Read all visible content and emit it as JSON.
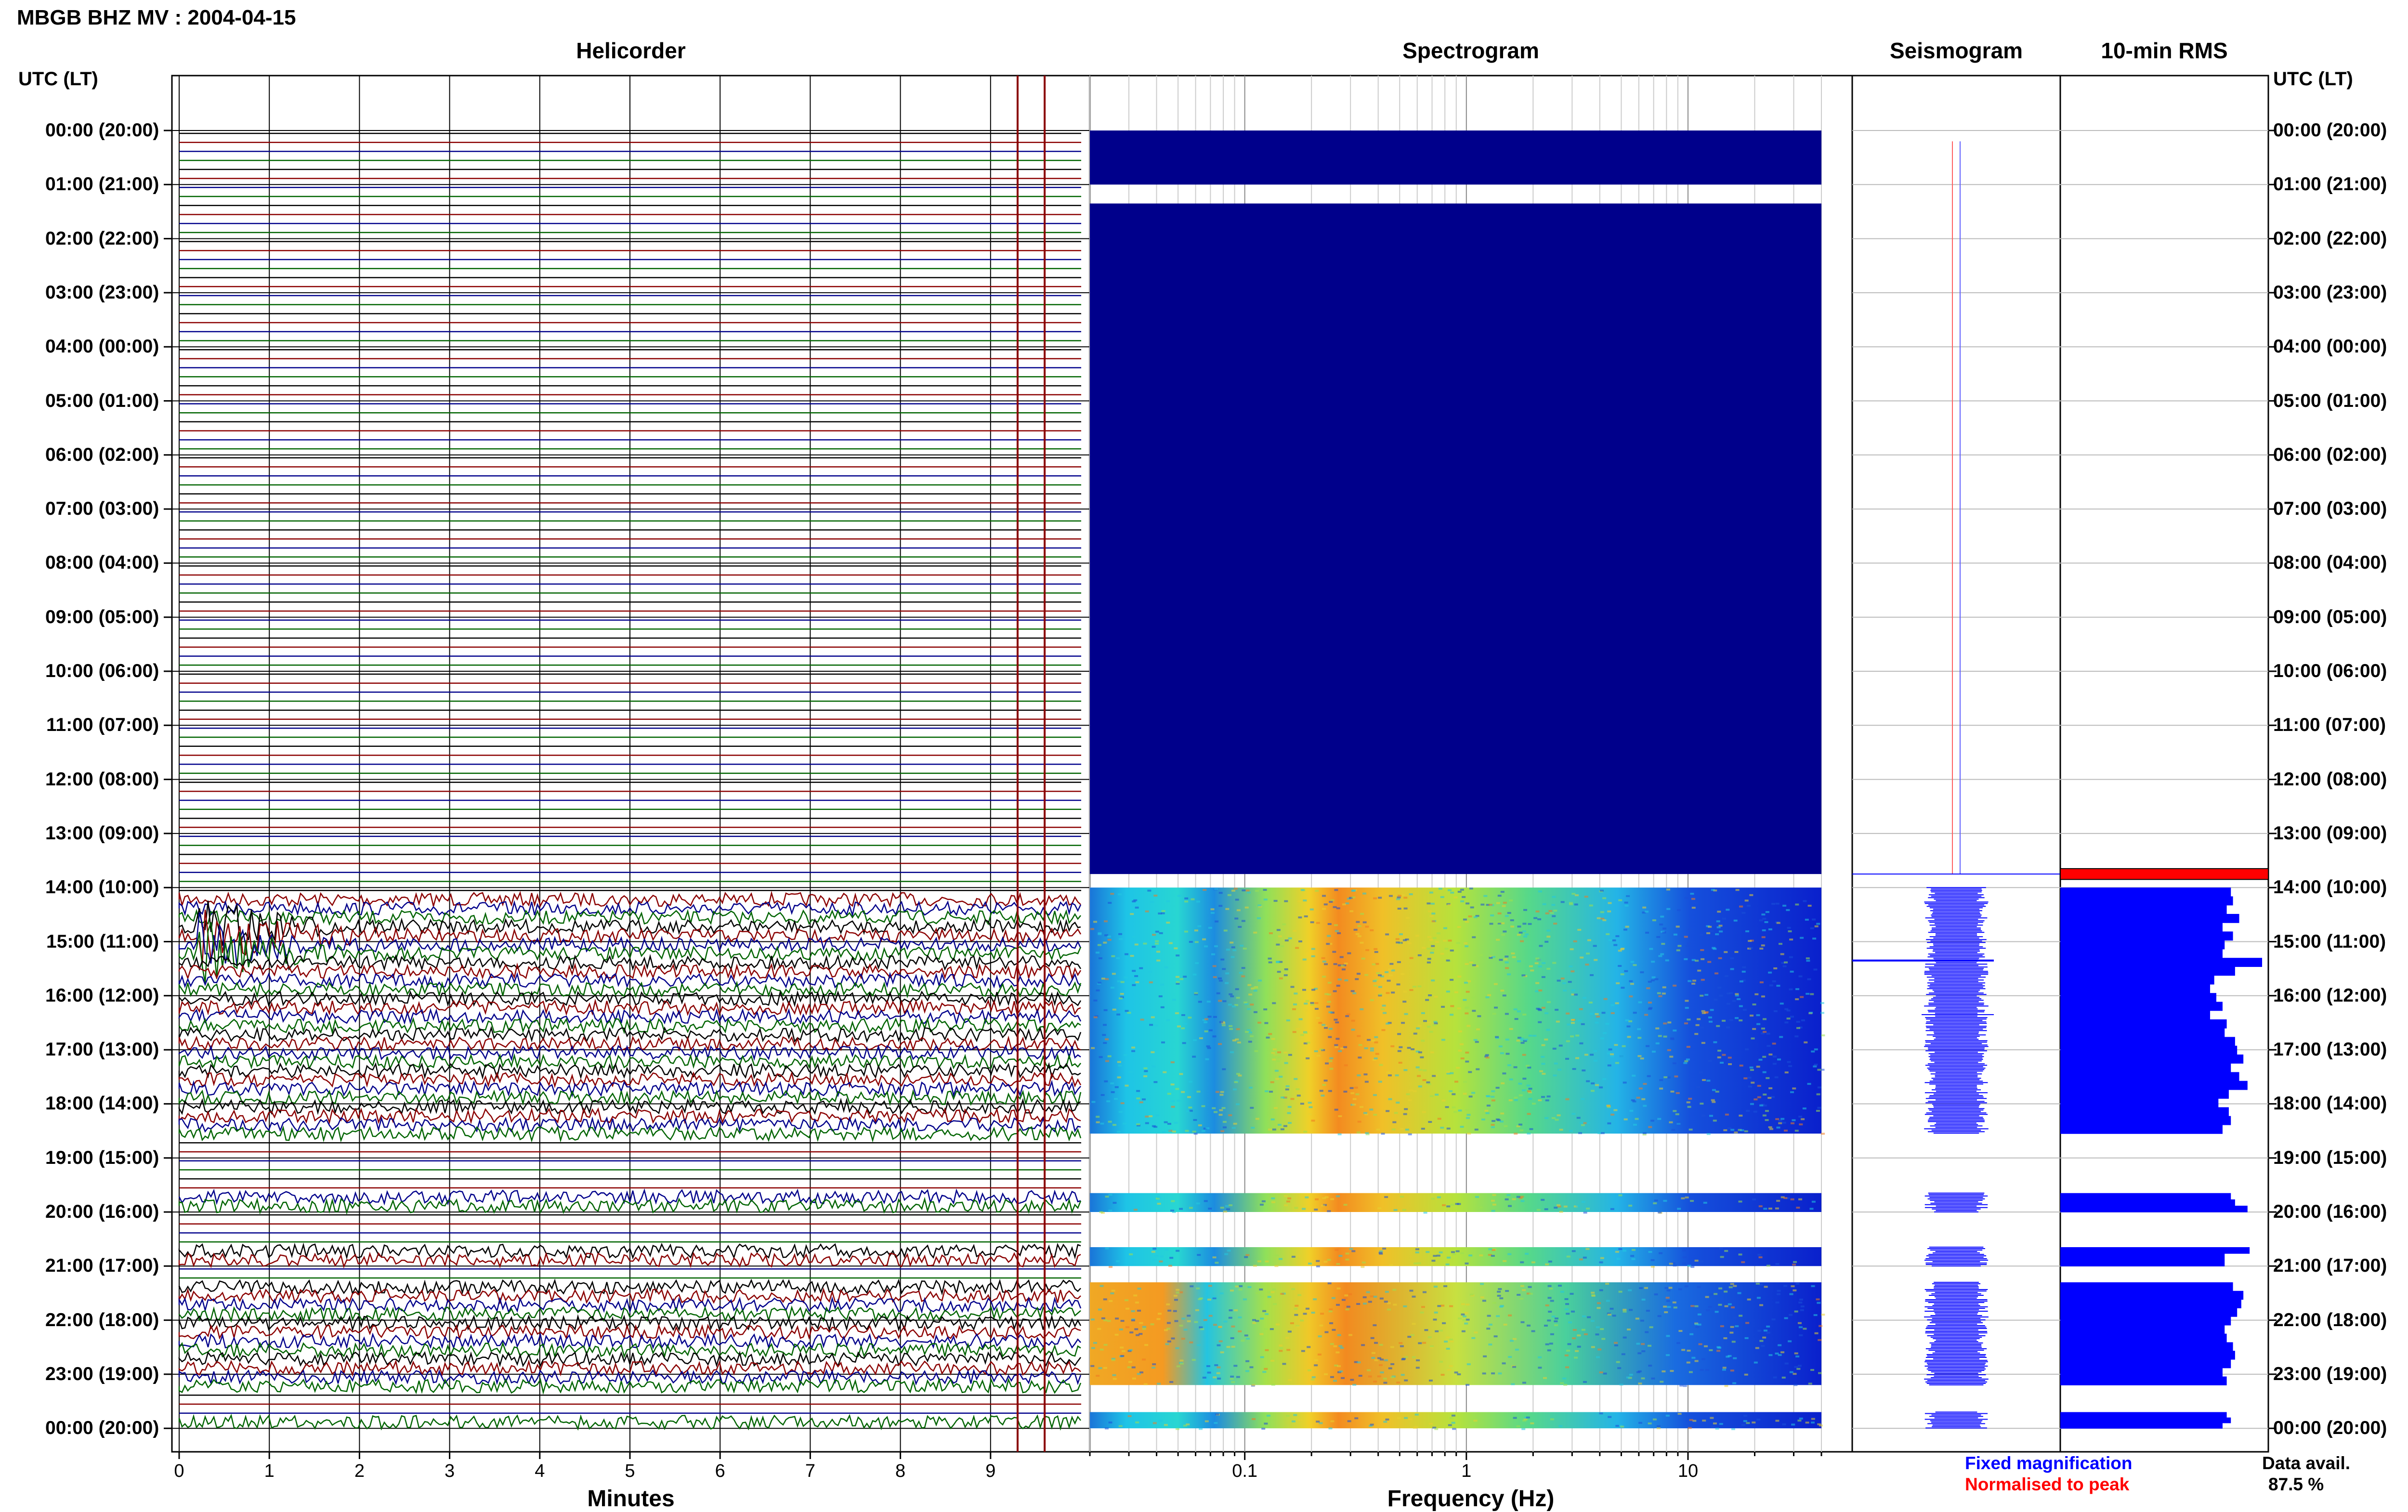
{
  "page": {
    "title": "MBGB BHZ MV : 2004-04-15"
  },
  "panels": {
    "helicorder": "Helicorder",
    "spectrogram": "Spectrogram",
    "seismogram": "Seismogram",
    "rms": "10-min RMS"
  },
  "axes": {
    "utc_label_left": "UTC (LT)",
    "utc_label_right": "UTC (LT)",
    "helicorder_xlabel": "Minutes",
    "spectrogram_xlabel": "Frequency (Hz)"
  },
  "legend": {
    "fixed": "Fixed magnification",
    "normalised": "Normalised to peak",
    "fixed_color": "#0000ff",
    "normalised_color": "#ff0000"
  },
  "availability": {
    "label": "Data avail.",
    "value": "87.5 %"
  },
  "chart_data": {
    "type": "heatmap",
    "title": "MBGB BHZ MV : 2004-04-15",
    "time_labels": [
      "00:00 (20:00)",
      "01:00 (21:00)",
      "02:00 (22:00)",
      "03:00 (23:00)",
      "04:00 (00:00)",
      "05:00 (01:00)",
      "06:00 (02:00)",
      "07:00 (03:00)",
      "08:00 (04:00)",
      "09:00 (05:00)",
      "10:00 (06:00)",
      "11:00 (07:00)",
      "12:00 (08:00)",
      "13:00 (09:00)",
      "14:00 (10:00)",
      "15:00 (11:00)",
      "16:00 (12:00)",
      "17:00 (13:00)",
      "18:00 (14:00)",
      "19:00 (15:00)",
      "20:00 (16:00)",
      "21:00 (17:00)",
      "22:00 (18:00)",
      "23:00 (19:00)",
      "00:00 (20:00)"
    ],
    "helicorder": {
      "xlabel": "Minutes",
      "xticks": [
        "0",
        "1",
        "2",
        "3",
        "4",
        "5",
        "6",
        "7",
        "8",
        "9"
      ],
      "xlim": [
        0,
        10
      ],
      "red_markers_min": [
        9.3,
        9.6
      ],
      "trace_colors": [
        "#000000",
        "#8b0000",
        "#00008b",
        "#006400"
      ],
      "active_segments_hours": [
        [
          14.0,
          18.55
        ],
        [
          19.65,
          20.0
        ],
        [
          20.65,
          21.0
        ],
        [
          21.3,
          23.2
        ],
        [
          23.7,
          24.0
        ]
      ]
    },
    "spectrogram": {
      "xlabel": "Frequency (Hz)",
      "xscale": "log",
      "xticks": [
        "0.1",
        "1",
        "10"
      ],
      "xlim": [
        0.02,
        40
      ],
      "no_data_blocks_hours": [
        [
          0.0,
          1.0
        ],
        [
          1.35,
          13.75
        ]
      ]
    },
    "seismogram": {
      "fixed_color": "#0000ff",
      "normalised_color": "#ff0000"
    },
    "rms": {
      "segments": [
        {
          "start": 13.65,
          "end": 13.85,
          "value": 1.0,
          "color": "#ff0000"
        },
        {
          "start": 14.0,
          "end": 18.55,
          "values": [
            0.82,
            0.83,
            0.8,
            0.86,
            0.78,
            0.83,
            0.79,
            0.78,
            0.97,
            0.84,
            0.74,
            0.72,
            0.75,
            0.78,
            0.72,
            0.8,
            0.79,
            0.84,
            0.85,
            0.88,
            0.82,
            0.86,
            0.9,
            0.81,
            0.76,
            0.81,
            0.82,
            0.78
          ],
          "color": "#0000ff"
        },
        {
          "start": 19.65,
          "end": 20.0,
          "values": [
            0.82,
            0.84,
            0.9
          ],
          "color": "#0000ff"
        },
        {
          "start": 20.65,
          "end": 21.0,
          "values": [
            0.91,
            0.79,
            0.79
          ],
          "color": "#0000ff"
        },
        {
          "start": 21.3,
          "end": 23.2,
          "values": [
            0.83,
            0.88,
            0.87,
            0.85,
            0.82,
            0.79,
            0.8,
            0.83,
            0.84,
            0.82,
            0.78,
            0.8
          ],
          "color": "#0000ff"
        },
        {
          "start": 23.7,
          "end": 24.0,
          "values": [
            0.8,
            0.82,
            0.78
          ],
          "color": "#0000ff"
        }
      ]
    }
  }
}
